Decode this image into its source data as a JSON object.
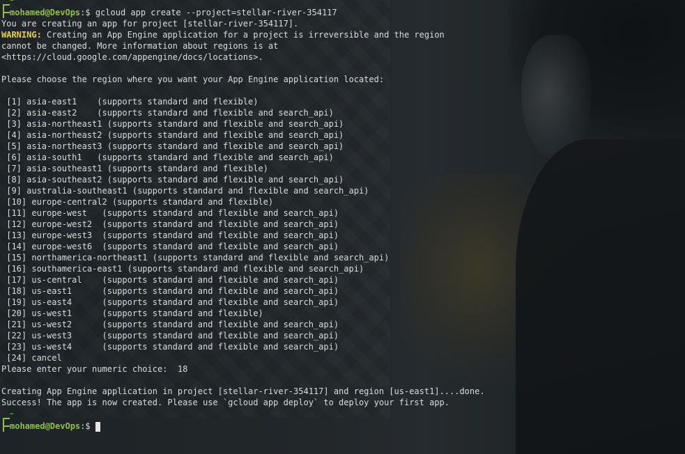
{
  "prompt": {
    "tilde": "~",
    "user_host": "mohamed@DevOps",
    "symbol": ":$"
  },
  "command": " gcloud app create --project=stellar-river-354117",
  "intro": [
    "You are creating an app for project [stellar-river-354117]."
  ],
  "warning": {
    "label": "WARNING:",
    "text": " Creating an App Engine application for a project is irreversible and the region"
  },
  "warning_cont": [
    "cannot be changed. More information about regions is at",
    "<https://cloud.google.com/appengine/docs/locations>."
  ],
  "choose_prompt": "Please choose the region where you want your App Engine application located:",
  "regions": [
    " [1] asia-east1    (supports standard and flexible)",
    " [2] asia-east2    (supports standard and flexible and search_api)",
    " [3] asia-northeast1 (supports standard and flexible and search_api)",
    " [4] asia-northeast2 (supports standard and flexible and search_api)",
    " [5] asia-northeast3 (supports standard and flexible and search_api)",
    " [6] asia-south1   (supports standard and flexible and search_api)",
    " [7] asia-southeast1 (supports standard and flexible)",
    " [8] asia-southeast2 (supports standard and flexible and search_api)",
    " [9] australia-southeast1 (supports standard and flexible and search_api)",
    " [10] europe-central2 (supports standard and flexible)",
    " [11] europe-west   (supports standard and flexible and search_api)",
    " [12] europe-west2  (supports standard and flexible and search_api)",
    " [13] europe-west3  (supports standard and flexible and search_api)",
    " [14] europe-west6  (supports standard and flexible and search_api)",
    " [15] northamerica-northeast1 (supports standard and flexible and search_api)",
    " [16] southamerica-east1 (supports standard and flexible and search_api)",
    " [17] us-central    (supports standard and flexible and search_api)",
    " [18] us-east1      (supports standard and flexible and search_api)",
    " [19] us-east4      (supports standard and flexible and search_api)",
    " [20] us-west1      (supports standard and flexible)",
    " [21] us-west2      (supports standard and flexible and search_api)",
    " [22] us-west3      (supports standard and flexible and search_api)",
    " [23] us-west4      (supports standard and flexible and search_api)",
    " [24] cancel"
  ],
  "choice_prompt": "Please enter your numeric choice:  18",
  "result": [
    "Creating App Engine application in project [stellar-river-354117] and region [us-east1]....done.",
    "Success! The app is now created. Please use `gcloud app deploy` to deploy your first app."
  ]
}
